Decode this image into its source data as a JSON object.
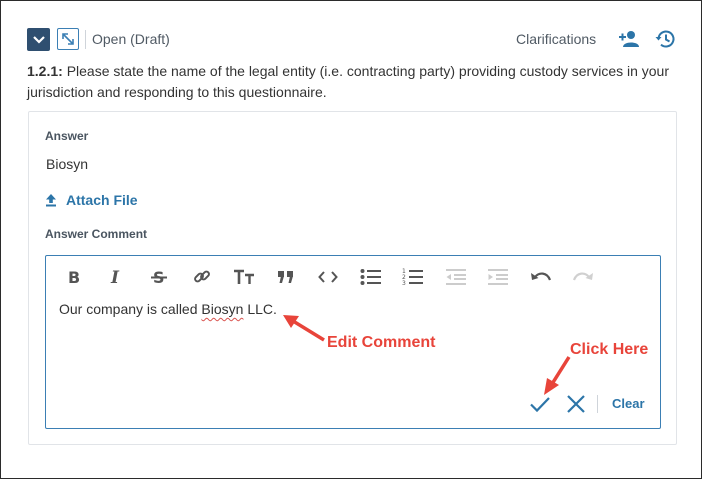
{
  "header": {
    "status": "Open (Draft)",
    "clarifications_label": "Clarifications",
    "icons": {
      "collapse": "chevron-down-icon",
      "expand": "expand-icon",
      "add_person": "add-person-icon",
      "history": "history-icon"
    }
  },
  "question": {
    "number": "1.2.1:",
    "text": " Please state the name of the legal entity (i.e. contracting party) providing custody services in your jurisdiction and responding to this questionnaire."
  },
  "answer": {
    "label": "Answer",
    "value": "Biosyn",
    "attach_label": "Attach File"
  },
  "comment": {
    "label": "Answer Comment",
    "text_before": "Our company is called ",
    "text_flagged": "Biosyn",
    "text_after": " LLC.",
    "toolbar": [
      "bold",
      "italic",
      "strikethrough",
      "link",
      "heading",
      "quote",
      "code",
      "bullet-list",
      "numbered-list",
      "outdent",
      "indent",
      "undo",
      "redo"
    ],
    "clear_label": "Clear"
  },
  "annotations": {
    "edit_comment": "Edit Comment",
    "click_here": "Click Here"
  },
  "colors": {
    "accent": "#2c75a8",
    "header_button": "#2f4f70",
    "annotation": "#e8443a",
    "editor_border": "#3b7fb4"
  }
}
